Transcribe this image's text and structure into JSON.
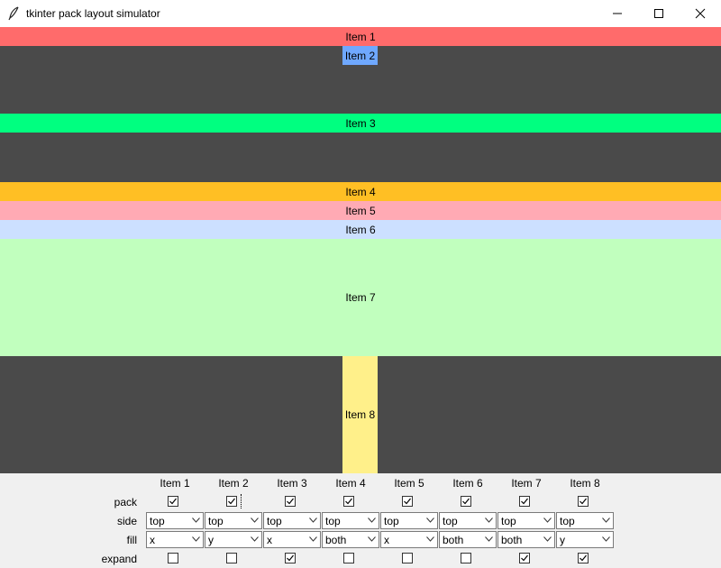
{
  "window": {
    "title": "tkinter pack layout simulator",
    "icon": "feather-icon",
    "controls": [
      "minimize-icon",
      "maximize-icon",
      "close-icon"
    ]
  },
  "canvas": {
    "background": "#4a4a4a",
    "items": [
      {
        "label": "Item 1",
        "color": "#ff6b6b"
      },
      {
        "label": "Item 2",
        "color": "#6fa8ff"
      },
      {
        "label": "Item 3",
        "color": "#00ff80"
      },
      {
        "label": "Item 4",
        "color": "#ffbf24"
      },
      {
        "label": "Item 5",
        "color": "#ffaab4"
      },
      {
        "label": "Item 6",
        "color": "#cce0ff"
      },
      {
        "label": "Item 7",
        "color": "#c1ffbe"
      },
      {
        "label": "Item 8",
        "color": "#fff08a"
      }
    ]
  },
  "controls": {
    "row_labels": {
      "pack": "pack",
      "side": "side",
      "fill": "fill",
      "expand": "expand"
    },
    "columns": [
      {
        "header": "Item 1",
        "pack": true,
        "side": "top",
        "fill": "x",
        "expand": false
      },
      {
        "header": "Item 2",
        "pack": true,
        "side": "top",
        "fill": "y",
        "expand": false
      },
      {
        "header": "Item 3",
        "pack": true,
        "side": "top",
        "fill": "x",
        "expand": true
      },
      {
        "header": "Item 4",
        "pack": true,
        "side": "top",
        "fill": "both",
        "expand": false
      },
      {
        "header": "Item 5",
        "pack": true,
        "side": "top",
        "fill": "x",
        "expand": false
      },
      {
        "header": "Item 6",
        "pack": true,
        "side": "top",
        "fill": "both",
        "expand": false
      },
      {
        "header": "Item 7",
        "pack": true,
        "side": "top",
        "fill": "both",
        "expand": true
      },
      {
        "header": "Item 8",
        "pack": true,
        "side": "top",
        "fill": "y",
        "expand": true
      }
    ]
  }
}
